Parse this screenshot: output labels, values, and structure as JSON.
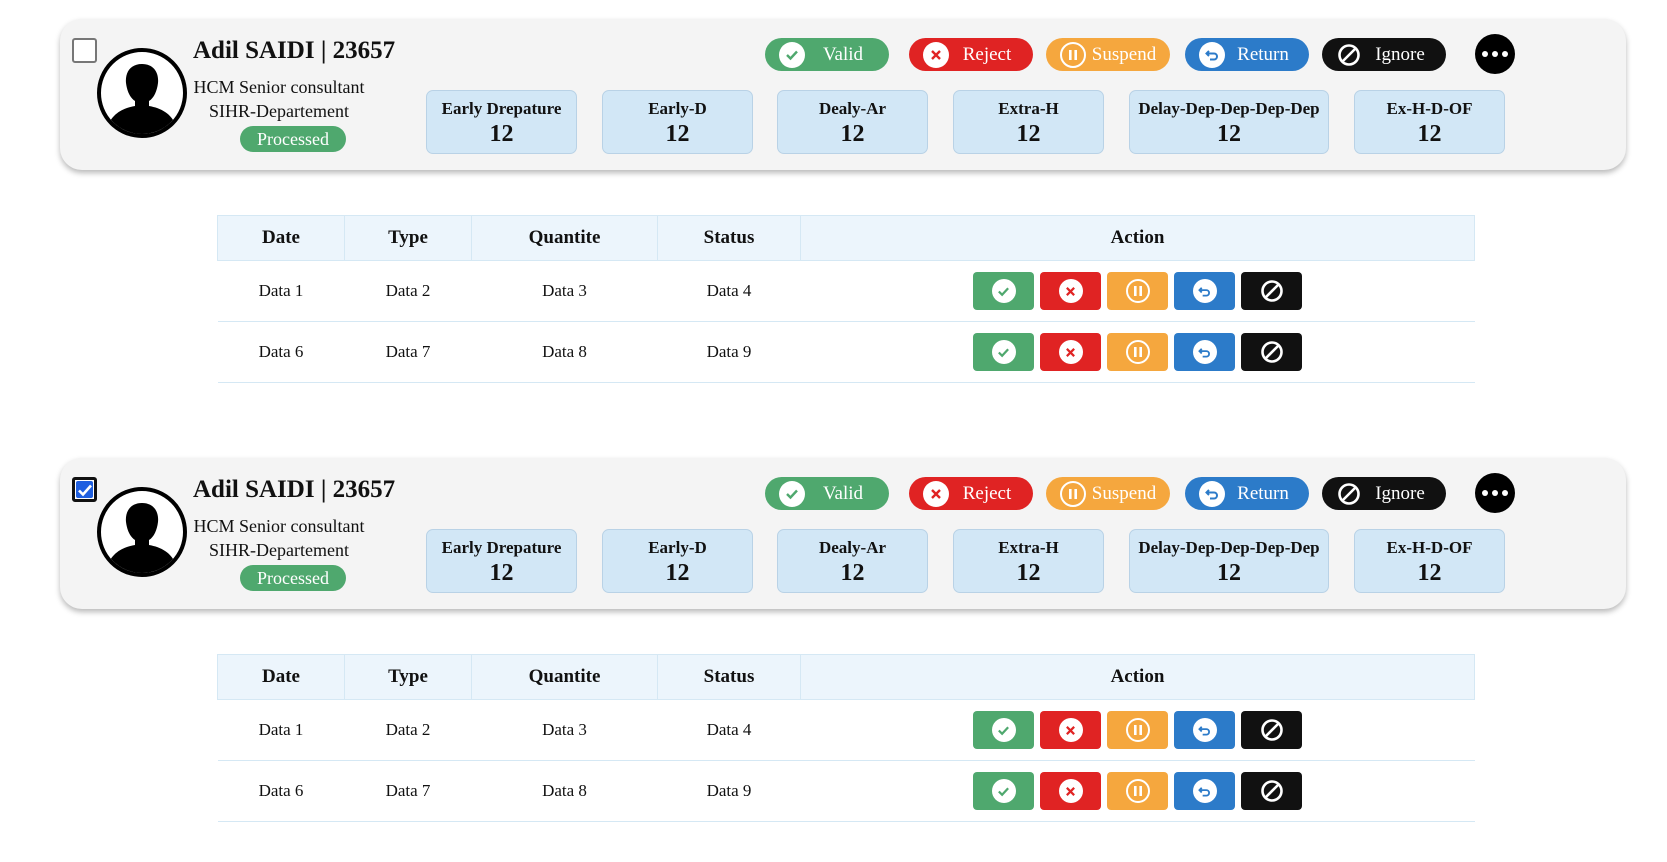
{
  "cards": [
    {
      "name": "Adil SAIDI | 23657",
      "role_line1": "HCM Senior consultant",
      "role_line2": "SIHR-Departement",
      "status": "Processed",
      "checked": false,
      "actions": [
        "Valid",
        "Reject",
        "Suspend",
        "Return",
        "Ignore"
      ],
      "stats": [
        {
          "label": "Early Drepature",
          "value": "12"
        },
        {
          "label": "Early-D",
          "value": "12"
        },
        {
          "label": "Dealy-Ar",
          "value": "12"
        },
        {
          "label": "Extra-H",
          "value": "12"
        },
        {
          "label": "Delay-Dep-Dep-Dep-Dep",
          "value": "12"
        },
        {
          "label": "Ex-H-D-OF",
          "value": "12"
        }
      ],
      "table": {
        "headers": [
          "Date",
          "Type",
          "Quantite",
          "Status",
          "Action"
        ],
        "rows": [
          [
            "Data 1",
            "Data 2",
            "Data 3",
            "Data 4"
          ],
          [
            "Data 6",
            "Data 7",
            "Data 8",
            "Data 9"
          ]
        ]
      }
    },
    {
      "name": "Adil SAIDI | 23657",
      "role_line1": "HCM Senior consultant",
      "role_line2": "SIHR-Departement",
      "status": "Processed",
      "checked": true,
      "actions": [
        "Valid",
        "Reject",
        "Suspend",
        "Return",
        "Ignore"
      ],
      "stats": [
        {
          "label": "Early Drepature",
          "value": "12"
        },
        {
          "label": "Early-D",
          "value": "12"
        },
        {
          "label": "Dealy-Ar",
          "value": "12"
        },
        {
          "label": "Extra-H",
          "value": "12"
        },
        {
          "label": "Delay-Dep-Dep-Dep-Dep",
          "value": "12"
        },
        {
          "label": "Ex-H-D-OF",
          "value": "12"
        }
      ],
      "table": {
        "headers": [
          "Date",
          "Type",
          "Quantite",
          "Status",
          "Action"
        ],
        "rows": [
          [
            "Data 1",
            "Data 2",
            "Data 3",
            "Data 4"
          ],
          [
            "Data 6",
            "Data 7",
            "Data 8",
            "Data 9"
          ]
        ]
      }
    }
  ],
  "colors": {
    "valid": "#4fa86e",
    "reject": "#e02323",
    "suspend": "#f5a73e",
    "return": "#2c7bc9",
    "ignore": "#111111",
    "processed": "#4fa86e",
    "stat_bg": "#d2e7f6",
    "checkbox_checked": "#1f5fe0"
  },
  "icons": {
    "valid": "check-circle-icon",
    "reject": "x-circle-icon",
    "suspend": "pause-circle-icon",
    "return": "return-arrow-icon",
    "ignore": "ban-icon",
    "more": "more-dots-icon",
    "avatar": "user-silhouette-icon"
  }
}
